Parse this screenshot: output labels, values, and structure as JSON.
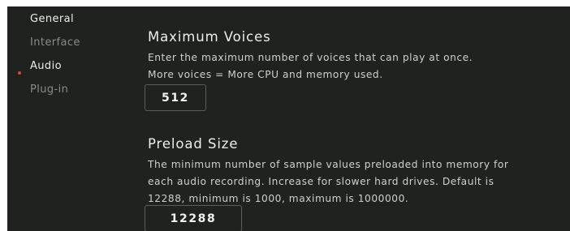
{
  "sidebar": {
    "items": [
      {
        "label": "General"
      },
      {
        "label": "Interface"
      },
      {
        "label": "Audio"
      },
      {
        "label": "Plug-in"
      }
    ],
    "active": "Audio",
    "indicator_color": "#d4453d"
  },
  "settings": {
    "max_voices": {
      "title": "Maximum Voices",
      "desc_line1": "Enter the maximum number of voices that can play at once.",
      "desc_line2": "More voices = More CPU and memory used.",
      "value": "512"
    },
    "preload_size": {
      "title": "Preload Size",
      "desc_line1": "The minimum number of sample values preloaded into memory for",
      "desc_line2": "each audio recording. Increase for slower hard drives. Default is",
      "desc_line3": "12288, minimum is 1000, maximum is 1000000.",
      "value": "12288"
    }
  },
  "colors": {
    "background": "#20221f",
    "text_primary": "#eeeeec",
    "text_muted": "#8a8c86",
    "accent": "#d4453d"
  }
}
